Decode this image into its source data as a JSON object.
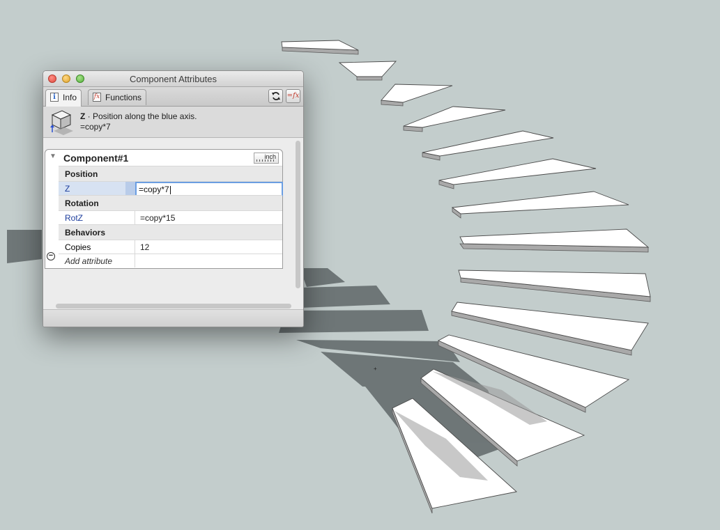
{
  "window": {
    "title": "Component Attributes"
  },
  "tabs": [
    {
      "label": "Info",
      "icon": "info-icon",
      "active": true
    },
    {
      "label": "Functions",
      "icon": "function-icon",
      "active": false
    }
  ],
  "toolbar": {
    "refresh_icon": "refresh-icon",
    "formula_icon": "formula-toggle-icon"
  },
  "info": {
    "attribute_name": "Z",
    "description": " · Position along the blue axis.",
    "formula": "=copy*7"
  },
  "component": {
    "name": "Component#1",
    "units_label": "inch",
    "sections": [
      {
        "title": "Position",
        "rows": [
          {
            "label": "Z",
            "value": "=copy*7",
            "editing": true
          }
        ]
      },
      {
        "title": "Rotation",
        "rows": [
          {
            "label": "RotZ",
            "value": "=copy*15"
          }
        ]
      },
      {
        "title": "Behaviors",
        "rows": [
          {
            "label": "Copies",
            "value": "12"
          }
        ]
      }
    ],
    "add_attribute_label": "Add attribute"
  },
  "colors": {
    "canvas_background": "#c3cdcc",
    "step_top": "#ffffff",
    "step_edge": "#a9a9a9",
    "shadow": "#6a7273",
    "selection_border": "#6b9ee2",
    "label_blue": "#1b3c9c"
  }
}
